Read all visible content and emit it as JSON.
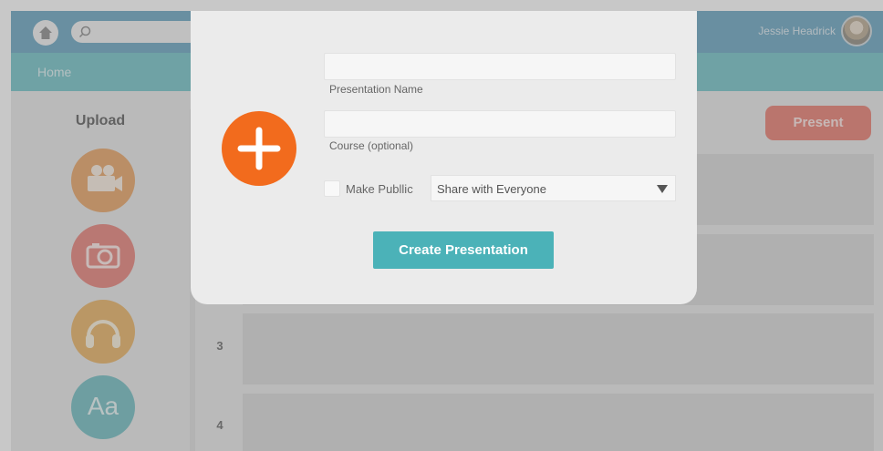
{
  "header": {
    "user_name": "Jessie Headrick",
    "search_placeholder": ""
  },
  "nav": {
    "home": "Home"
  },
  "sidebar": {
    "title": "Upload",
    "buttons": [
      {
        "icon": "video-camera-icon",
        "color": "#e8a262"
      },
      {
        "icon": "camera-icon",
        "color": "#e77f76"
      },
      {
        "icon": "headphones-icon",
        "color": "#e8b15f"
      },
      {
        "icon": "text-aa-icon",
        "color": "#6fbcc0",
        "text": "Aa"
      }
    ]
  },
  "main": {
    "present_label": "Present",
    "rows": [
      "",
      "",
      "3",
      "4"
    ]
  },
  "modal": {
    "name_value": "",
    "name_label": "Presentation Name",
    "course_value": "",
    "course_label": "Course (optional)",
    "make_public_label": "Make Publlic",
    "share_selected": "Share with Everyone",
    "create_label": "Create Presentation",
    "accent": "#f26b1d",
    "button_color": "#4bb2b8"
  }
}
